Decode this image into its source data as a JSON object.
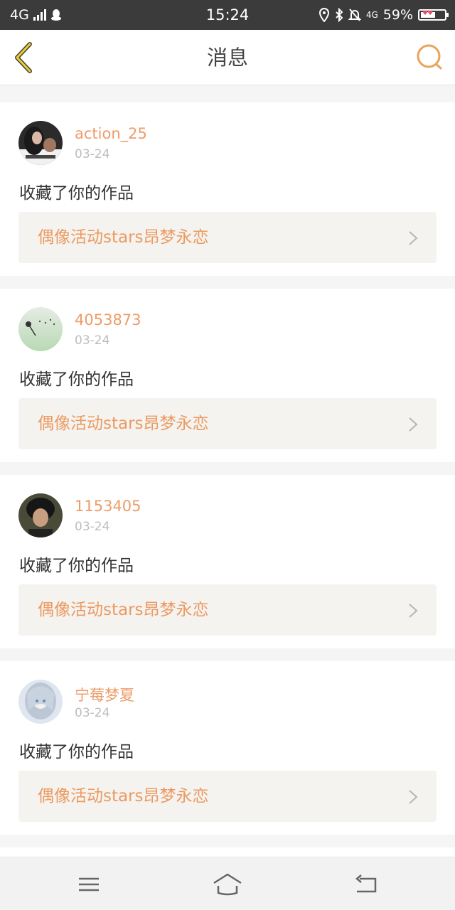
{
  "status_bar": {
    "network": "4G",
    "time": "15:24",
    "network_small": "4G",
    "battery_percent": "59%",
    "battery_level": 0.59,
    "icons": [
      "signal-icon",
      "qq-icon",
      "location-icon",
      "bluetooth-icon",
      "bell-off-icon",
      "battery-icon"
    ]
  },
  "header": {
    "title": "消息",
    "back_icon": "chevron-left-icon",
    "search_icon": "search-icon",
    "accent_color": "#e8a45b",
    "back_color": "#c9b43a"
  },
  "notifications": [
    {
      "username": "action_25",
      "date": "03-24",
      "action": "收藏了你的作品",
      "work_title": "偶像活动stars昂梦永恋"
    },
    {
      "username": "4053873",
      "date": "03-24",
      "action": "收藏了你的作品",
      "work_title": "偶像活动stars昂梦永恋"
    },
    {
      "username": "1153405",
      "date": "03-24",
      "action": "收藏了你的作品",
      "work_title": "偶像活动stars昂梦永恋"
    },
    {
      "username": "宁莓梦夏",
      "date": "03-24",
      "action": "收藏了你的作品",
      "work_title": "偶像活动stars昂梦永恋"
    }
  ],
  "bottom_nav": {
    "icons": [
      "menu-icon",
      "home-icon",
      "back-icon"
    ]
  },
  "colors": {
    "username": "#ed9c68",
    "date": "#bdbdbd",
    "work_title": "#ec9a62",
    "work_bg": "#f4f3ef"
  }
}
